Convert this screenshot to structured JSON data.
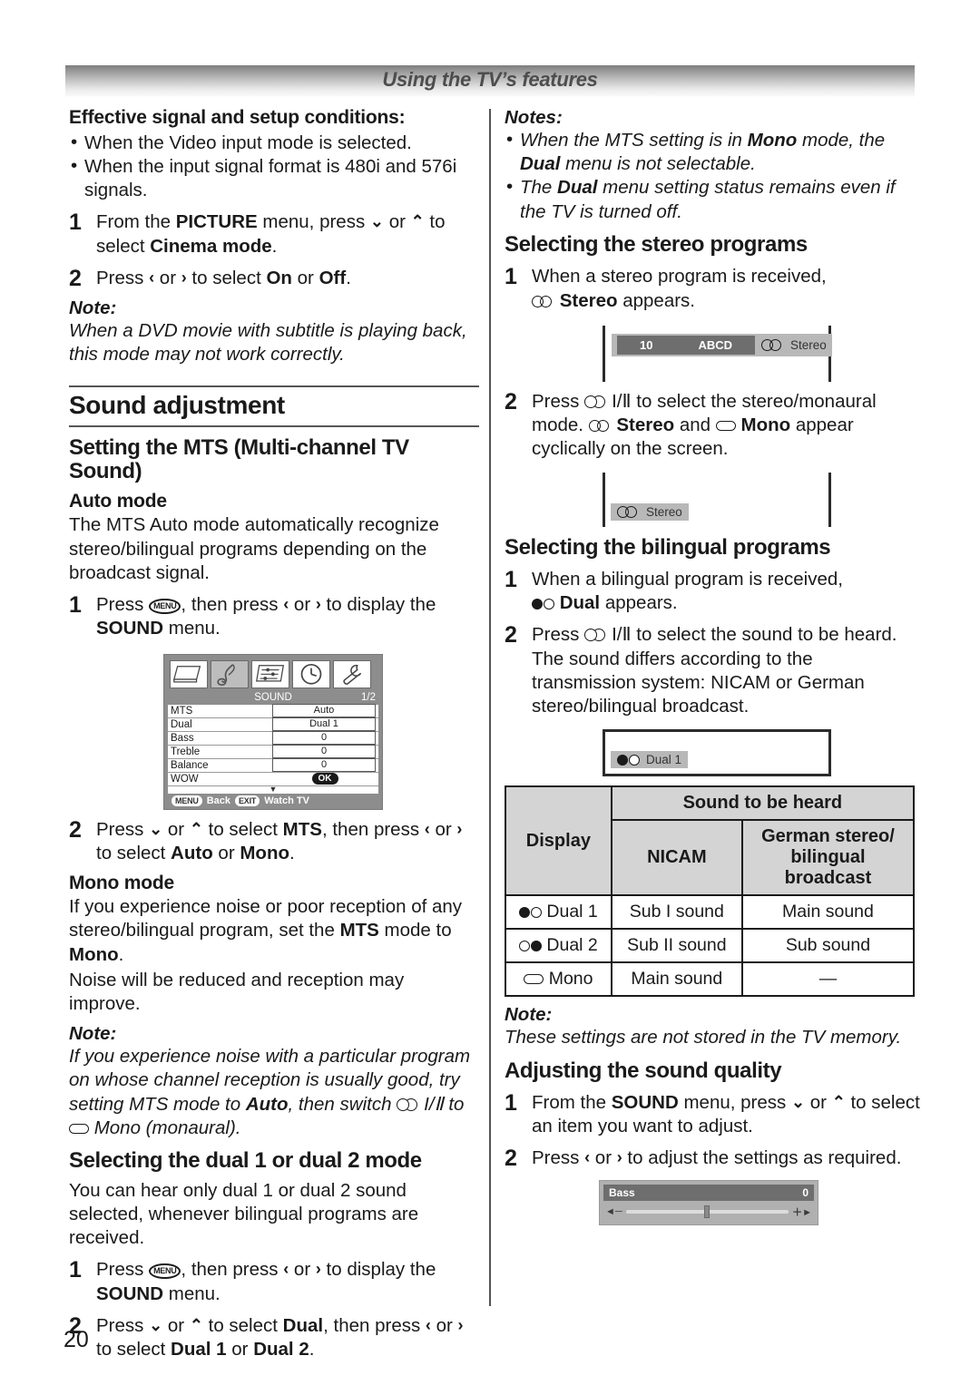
{
  "header": {
    "title": "Using the TV’s features"
  },
  "page_number": "20",
  "left": {
    "effective_heading": "Effective signal and setup conditions:",
    "effective_bullets": [
      "When the Video input mode is selected.",
      "When the input signal format is 480i and 576i signals."
    ],
    "step1_num": "1",
    "step1_a": "From the ",
    "step1_b": "PICTURE",
    "step1_c": " menu, press ",
    "step1_d": " or ",
    "step1_e": " to select ",
    "step1_f": "Cinema mode",
    "step1_g": ".",
    "step2_num": "2",
    "step2_a": "Press ",
    "step2_b": " or ",
    "step2_c": " to select ",
    "step2_d": "On",
    "step2_e": " or ",
    "step2_f": "Off",
    "step2_g": ".",
    "note_label": "Note:",
    "note_text": "When a DVD movie with subtitle is playing back, this mode may not work correctly.",
    "section_title": "Sound adjustment",
    "mts_heading": "Setting the MTS (Multi-channel TV Sound)",
    "auto_heading": "Auto mode",
    "auto_text": "The MTS Auto mode automatically recognize stereo/bilingual programs depending on the broadcast signal.",
    "auto_step1_num": "1",
    "auto_step1_a": "Press ",
    "auto_step1_menu": "MENU",
    "auto_step1_b": ", then press ",
    "auto_step1_c": " or ",
    "auto_step1_d": " to display the ",
    "auto_step1_e": "SOUND",
    "auto_step1_f": " menu.",
    "auto_step2_num": "2",
    "auto_step2_a": "Press ",
    "auto_step2_b": " or ",
    "auto_step2_c": " to select ",
    "auto_step2_d": "MTS",
    "auto_step2_e": ", then press ",
    "auto_step2_f": " or ",
    "auto_step2_g": " to select ",
    "auto_step2_h": "Auto",
    "auto_step2_i": " or ",
    "auto_step2_j": "Mono",
    "auto_step2_k": ".",
    "mono_heading": "Mono mode",
    "mono_text_a": "If you experience noise or poor reception of any stereo/bilingual program, set the ",
    "mono_text_b": "MTS",
    "mono_text_c": " mode to ",
    "mono_text_d": "Mono",
    "mono_text_e": ".",
    "mono_text_f": "Noise will be reduced and reception may improve.",
    "mono_note_label": "Note:",
    "mono_note_a": "If you experience noise with a particular program on whose channel reception is usually good, try setting MTS mode to ",
    "mono_note_b": "Auto",
    "mono_note_c": ", then switch ",
    "mono_note_d": "I/Ⅱ",
    "mono_note_e": " to ",
    "mono_note_f": " Mono (monaural).",
    "dual_heading": "Selecting the dual 1 or dual 2 mode",
    "dual_text": "You can hear only dual 1 or dual 2 sound selected, whenever bilingual programs are received.",
    "dual_step1_num": "1",
    "dual_step1_a": "Press ",
    "dual_step1_menu": "MENU",
    "dual_step1_b": ", then press ",
    "dual_step1_c": " or ",
    "dual_step1_d": " to display the ",
    "dual_step1_e": "SOUND",
    "dual_step1_f": " menu.",
    "dual_step2_num": "2",
    "dual_step2_a": "Press ",
    "dual_step2_b": " or ",
    "dual_step2_c": " to select ",
    "dual_step2_d": "Dual",
    "dual_step2_e": ", then press ",
    "dual_step2_f": " or ",
    "dual_step2_g": " to select ",
    "dual_step2_h": "Dual 1",
    "dual_step2_i": " or ",
    "dual_step2_j": "Dual 2",
    "dual_step2_k": "."
  },
  "osd_sound": {
    "title": "SOUND",
    "page": "1/2",
    "icons": [
      "picture-icon",
      "sound-icon",
      "feature-icon",
      "timer-icon",
      "setup-icon"
    ],
    "selected_icon_index": 1,
    "rows": [
      {
        "label": "MTS",
        "value": "Auto"
      },
      {
        "label": "Dual",
        "value": "Dual 1"
      },
      {
        "label": "Bass",
        "value": "0"
      },
      {
        "label": "Treble",
        "value": "0"
      },
      {
        "label": "Balance",
        "value": "0"
      },
      {
        "label": "WOW",
        "value": "OK"
      }
    ],
    "footer_key1": "MENU",
    "footer_text1": "Back",
    "footer_key2": "EXIT",
    "footer_text2": "Watch TV"
  },
  "right": {
    "notes_label": "Notes:",
    "notes": [
      {
        "a": "When the MTS setting is in ",
        "b": "Mono",
        "c": " mode, the ",
        "d": "Dual",
        "e": " menu is not selectable."
      },
      {
        "a": "The ",
        "b": "Dual",
        "c": " menu setting status remains even if the TV is turned off.",
        "d": "",
        "e": ""
      }
    ],
    "stereo_heading": "Selecting the stereo programs",
    "stereo_step1_num": "1",
    "stereo_step1_a": "When a stereo program is received,",
    "stereo_step1_b": "Stereo",
    "stereo_step1_c": " appears.",
    "stereo_step2_num": "2",
    "stereo_step2_a": "Press ",
    "stereo_step2_btn": "I/Ⅱ",
    "stereo_step2_b": " to select the stereo/monaural mode. ",
    "stereo_step2_c": "Stereo",
    "stereo_step2_d": " and ",
    "stereo_step2_e": "Mono",
    "stereo_step2_f": " appear cyclically on the screen.",
    "bilingual_heading": "Selecting the bilingual programs",
    "bi_step1_num": "1",
    "bi_step1_a": "When a bilingual program is received,",
    "bi_step1_b": "Dual",
    "bi_step1_c": " appears.",
    "bi_step2_num": "2",
    "bi_step2_a": "Press ",
    "bi_step2_btn": "I/Ⅱ",
    "bi_step2_b": " to select the sound to be heard. The sound differs according to the transmission system: NICAM or German stereo/bilingual broadcast.",
    "table_note_label": "Note:",
    "table_note_text": "These settings are not stored in the TV memory.",
    "quality_heading": "Adjusting the sound quality",
    "q_step1_num": "1",
    "q_step1_a": "From the ",
    "q_step1_b": "SOUND",
    "q_step1_c": " menu, press ",
    "q_step1_d": " or ",
    "q_step1_e": " to select an item you want to adjust.",
    "q_step2_num": "2",
    "q_step2_a": "Press ",
    "q_step2_b": " or ",
    "q_step2_c": " to adjust the settings as required."
  },
  "tv_screens": {
    "screen1_channel": "10",
    "screen1_name": "ABCD",
    "screen1_mode": "Stereo",
    "screen2_mode": "Stereo",
    "screen3_mode": "Dual  1"
  },
  "sound_table": {
    "header_span": "Sound to be heard",
    "header_display": "Display",
    "header_nicam": "NICAM",
    "header_german": "German stereo/ bilingual broadcast",
    "header_german_lines": [
      "German stereo/",
      "bilingual",
      "broadcast"
    ],
    "rows": [
      {
        "display": "Dual 1",
        "symbol": "filled-empty",
        "nicam": "Sub I sound",
        "german": "Main sound"
      },
      {
        "display": "Dual 2",
        "symbol": "empty-filled",
        "nicam": "Sub II sound",
        "german": "Sub sound"
      },
      {
        "display": "Mono",
        "symbol": "oval",
        "nicam": "Main sound",
        "german": "—"
      }
    ]
  },
  "bass_osd": {
    "label": "Bass",
    "value": "0",
    "minus": "◄─",
    "plus": "＋►"
  }
}
